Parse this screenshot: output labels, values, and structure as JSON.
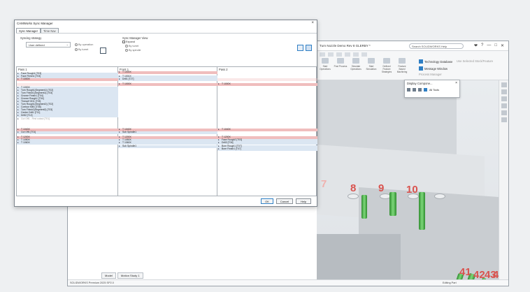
{
  "cad": {
    "title": "Turn Nozzle Demo Rev 8 GLERBY *",
    "search": "Search SOLIDWORKS Help",
    "toolbar_icons": [
      "❤",
      "?",
      "—",
      "□",
      "✕"
    ],
    "ribbon_buttons": [
      "Start Operations",
      "Post Process",
      "Simulate Operations",
      "Start Simulation",
      "Defined Feature Strategies",
      "Feature Based Machining"
    ],
    "ribbon_items": [
      "Technology Database",
      "Use Selected Stock/Feature",
      "Message Window",
      "Process Manager"
    ],
    "tabs": [
      "Model",
      "Motion Study 1"
    ],
    "status_left": "SOLIDWORKS Premium 2025 SP2.0",
    "status_right": "Editing Part",
    "numbers": [
      "7",
      "8",
      "9",
      "10",
      "41",
      "42",
      "43",
      "44"
    ],
    "mini_dialog": {
      "title": "Display Compone...",
      "label": "All Tools"
    }
  },
  "dialog": {
    "title": "CAMWorks Sync Manager",
    "tabs": [
      "Sync Manager",
      "Time Nav"
    ],
    "syncing_strategy_label": "Syncing strategy",
    "strategy_value": "User defined",
    "by_operation": "By operation",
    "by_turret": "By turret",
    "view_label": "Sync Manager View",
    "expand_label": "Expand",
    "by_turret2": "By turret",
    "by_spindle": "By spindle",
    "columns": [
      "Pass 1",
      "Front 1",
      "Pass 2"
    ],
    "pass1_rows": [
      {
        "text": "Face Rough1 [T03]",
        "style": "blue"
      },
      {
        "text": "Face Finish1 [T03]",
        "style": "blue"
      },
      {
        "text": "T 1000X",
        "style": "red"
      },
      {
        "text": "",
        "style": ""
      },
      {
        "text": "T 1000X",
        "style": "blue"
      },
      {
        "text": "Turn Rough1(Segment1) [T02]",
        "style": "blue"
      },
      {
        "text": "Turn Finish1(Segment1) [T03]",
        "style": "blue"
      },
      {
        "text": "Groove Finish1 [T04]",
        "style": "blue"
      },
      {
        "text": "Groove Rough1 [T04]",
        "style": "blue"
      },
      {
        "text": "Thread+OD1 [T03]",
        "style": "blue"
      },
      {
        "text": "Turn Rough1(Segment2) [T02]",
        "style": "blue"
      },
      {
        "text": "Contour Mill1 [T08]",
        "style": "blue"
      },
      {
        "text": "Turn Finish2(Segment2) [T03]",
        "style": "blue"
      },
      {
        "text": "Center Drill1 [T11]",
        "style": "blue"
      },
      {
        "text": "Drill2 [T12]",
        "style": "blue"
      },
      {
        "text": "Cut Off1 - First cutout [T01]",
        "style": "pale"
      },
      {
        "text": "T 1040X",
        "style": "red"
      },
      {
        "text": "Cut Off1 [T01]",
        "style": "blue"
      },
      {
        "text": "T 1200X",
        "style": "red"
      },
      {
        "text": "T 1050X",
        "style": "blue"
      },
      {
        "text": "T 1060X",
        "style": "blue"
      }
    ],
    "front1_rows": [
      {
        "text": "T 1000X",
        "style": "red"
      },
      {
        "text": "T 1001X",
        "style": "blue"
      },
      {
        "text": "Drill1 [T27]",
        "style": "blue"
      },
      {
        "text": "T 1000X",
        "style": "red"
      },
      {
        "text": "T 1040X",
        "style": "red"
      },
      {
        "text": "Sub Spindle1",
        "style": "blue"
      },
      {
        "text": "T 1200X",
        "style": "red"
      },
      {
        "text": "T 1050X",
        "style": "blue"
      },
      {
        "text": "T 1060X",
        "style": "blue"
      },
      {
        "text": "Sub Spindle1",
        "style": "blue"
      }
    ],
    "pass2_rows": [
      {
        "text": "T 1000X",
        "style": "red"
      },
      {
        "text": "T 1040X",
        "style": "red"
      },
      {
        "text": "T 1200X",
        "style": "red"
      },
      {
        "text": "Face Rough2 [T03]",
        "style": "blue"
      },
      {
        "text": "Drill3 [T06]",
        "style": "blue"
      },
      {
        "text": "Bore Rough1 [T07]",
        "style": "blue"
      },
      {
        "text": "Bore Finish1 [T07]",
        "style": "blue"
      }
    ],
    "buttons": {
      "ok": "OK",
      "cancel": "Cancel",
      "help": "Help"
    }
  }
}
